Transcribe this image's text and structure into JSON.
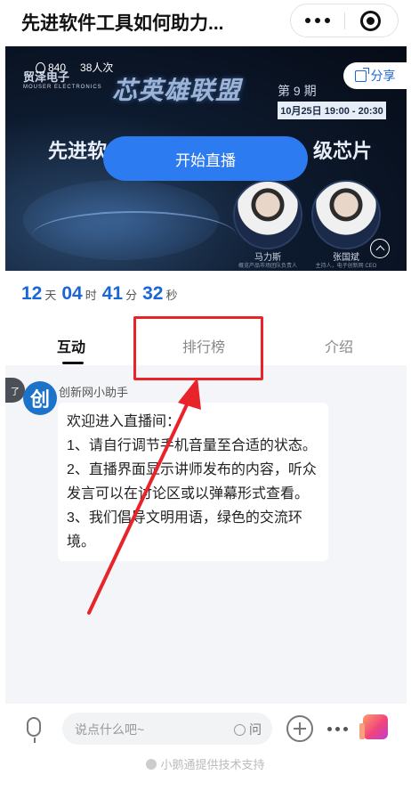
{
  "header": {
    "title": "先进软件工具如何助力..."
  },
  "banner": {
    "hot_count": "840",
    "viewers": "38人次",
    "logo_text": "贸泽电子",
    "logo_sub": "MOUSER ELECTRONICS",
    "share_label": "分享",
    "event_title": "芯英雄联盟",
    "episode": "第 9 期",
    "date": "10月25日 19:00 - 20:30",
    "headline_left": "先进软",
    "headline_right": "级芯片",
    "start_live_label": "开始直播",
    "speakers": [
      {
        "name": "马力斯",
        "role": "概览产品市场团队负责人"
      },
      {
        "name": "张国斌",
        "role": "主持人，电子创新网 CEO"
      }
    ]
  },
  "countdown": {
    "days": "12",
    "days_unit": "天",
    "hours": "04",
    "hours_unit": "时",
    "minutes": "41",
    "minutes_unit": "分",
    "seconds": "32",
    "seconds_unit": "秒"
  },
  "tabs": [
    {
      "label": "互动",
      "active": true
    },
    {
      "label": "排行榜",
      "active": false
    },
    {
      "label": "介绍",
      "active": false
    }
  ],
  "chat": {
    "edge_tag": "了",
    "avatar_char": "创",
    "sender": "创新网小助手",
    "lines": [
      "欢迎进入直播间：",
      "1、请自行调节手机音量至合适的状态。",
      "2、直播界面显示讲师发布的内容，听众发言可以在讨论区或以弹幕形式查看。",
      "3、我们倡导文明用语，绿色的交流环境。"
    ]
  },
  "input": {
    "placeholder": "说点什么吧~",
    "ask_label": "问"
  },
  "footer": {
    "powered_by": "小鹅通提供技术支持"
  },
  "colors": {
    "accent": "#1a66d6",
    "live_button": "#2d7bf0",
    "annotation_red": "#e8232a"
  }
}
